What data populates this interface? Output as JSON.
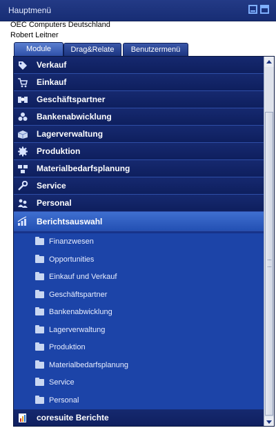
{
  "window": {
    "title": "Hauptmenü"
  },
  "company": "OEC Computers Deutschland",
  "user": "Robert Leitner",
  "tabs": [
    {
      "label": "Module",
      "active": true
    },
    {
      "label": "Drag&Relate",
      "active": false
    },
    {
      "label": "Benutzermenü",
      "active": false
    }
  ],
  "modules": [
    {
      "label": "Verkauf",
      "icon": "tag-icon"
    },
    {
      "label": "Einkauf",
      "icon": "cart-icon"
    },
    {
      "label": "Geschäftspartner",
      "icon": "business-partner-icon"
    },
    {
      "label": "Bankenabwicklung",
      "icon": "coins-icon"
    },
    {
      "label": "Lagerverwaltung",
      "icon": "warehouse-box-icon"
    },
    {
      "label": "Produktion",
      "icon": "gear-icon"
    },
    {
      "label": "Materialbedarfsplanung",
      "icon": "planning-icon"
    },
    {
      "label": "Service",
      "icon": "wrench-icon"
    },
    {
      "label": "Personal",
      "icon": "people-icon"
    },
    {
      "label": "Berichtsauswahl",
      "icon": "report-chart-icon",
      "selected": true
    }
  ],
  "report_folders": [
    "Finanzwesen",
    "Opportunities",
    "Einkauf und Verkauf",
    "Geschäftspartner",
    "Bankenabwicklung",
    "Lagerverwaltung",
    "Produktion",
    "Materialbedarfsplanung",
    "Service",
    "Personal"
  ],
  "last_module": {
    "label": "coresuite Berichte",
    "icon": "coresuite-report-icon"
  },
  "colors": {
    "title_bar": "#1b3380",
    "module_row": "#12276a",
    "selected_row": "#3563c4",
    "subfolder_area": "#1c44a8"
  }
}
